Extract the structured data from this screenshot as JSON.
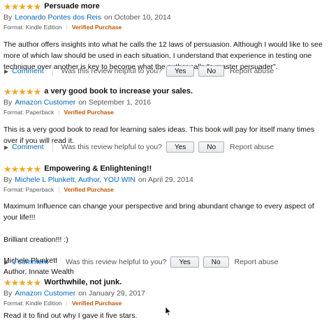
{
  "colors": {
    "star": "#f5a623",
    "link": "#0066c0",
    "verified": "#c45500"
  },
  "reviews": [
    {
      "stars": "★★★★★",
      "title": "Persuade more",
      "by": "By",
      "author": "Leonardo Pontes dos Reis",
      "date": "on October 10, 2014",
      "format": "Format: Kindle Edition",
      "verified": "Verified Purchase",
      "body": [
        "The author offers insights into what he calls the 12 laws of persuasion. Although I would like to see more of which law should be used in each situation, I understand that experience in testing one technique over another is key to become what the author calls \"a master persuader\"."
      ],
      "comment": "Comment",
      "helpful": "Was this review helpful to you?",
      "yes": "Yes",
      "no": "No",
      "abuse": "Report abuse"
    },
    {
      "stars": "★★★★★",
      "title": "a very good book to increase your sales.",
      "by": "By",
      "author": "Amazon Customer",
      "date": "on September 1, 2016",
      "format": "Format: Paperback",
      "verified": "Verified Purchase",
      "body": [
        "This is a very good book to read for learning sales ideas. This book will pay for itself many times over if you will read it."
      ],
      "comment": "Comment",
      "helpful": "Was this review helpful to you?",
      "yes": "Yes",
      "no": "No",
      "abuse": "Report abuse"
    },
    {
      "stars": "★★★★★",
      "title": "Empowering & Enlightening!!",
      "by": "By",
      "author": "Michele L Plunkett, Author, YOU WIN",
      "date": "on April 29, 2014",
      "format": "Format: Paperback",
      "verified": "Verified Purchase",
      "body": [
        "Maximum Influence can change your perspective and bring abundant change to every aspect of your life!!!",
        "Brilliant creation!!! :)",
        "Michele Plunkett",
        "Author, Innate Wealth"
      ],
      "comment": "1 comment",
      "helpful": "Was this review helpful to you?",
      "yes": "Yes",
      "no": "No",
      "abuse": "Report abuse"
    },
    {
      "stars": "★★★★★",
      "title": "Worthwhile, not junk.",
      "by": "By",
      "author": "Amazon Customer",
      "date": "on January 29, 2017",
      "format": "Format: Kindle Edition",
      "verified": "Verified Purchase",
      "body": [
        "Read it to find out why I gave it five stars."
      ]
    }
  ]
}
